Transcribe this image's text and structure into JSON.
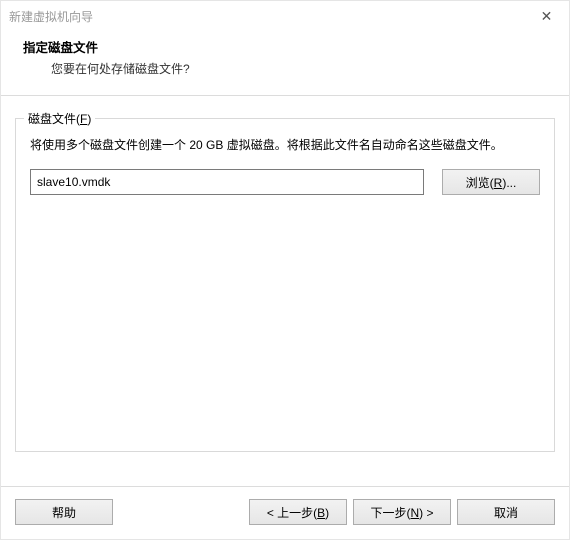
{
  "window": {
    "title": "新建虚拟机向导"
  },
  "header": {
    "title": "指定磁盘文件",
    "subtitle": "您要在何处存储磁盘文件?"
  },
  "fieldset": {
    "legend_pre": "磁盘文件(",
    "legend_key": "F",
    "legend_post": ")",
    "description": "将使用多个磁盘文件创建一个 20 GB 虚拟磁盘。将根据此文件名自动命名这些磁盘文件。",
    "filename": "slave10.vmdk",
    "browse_pre": "浏览(",
    "browse_key": "R",
    "browse_post": ")..."
  },
  "footer": {
    "help": "帮助",
    "back_pre": "< 上一步(",
    "back_key": "B",
    "back_post": ")",
    "next_pre": "下一步(",
    "next_key": "N",
    "next_post": ") >",
    "cancel": "取消"
  }
}
